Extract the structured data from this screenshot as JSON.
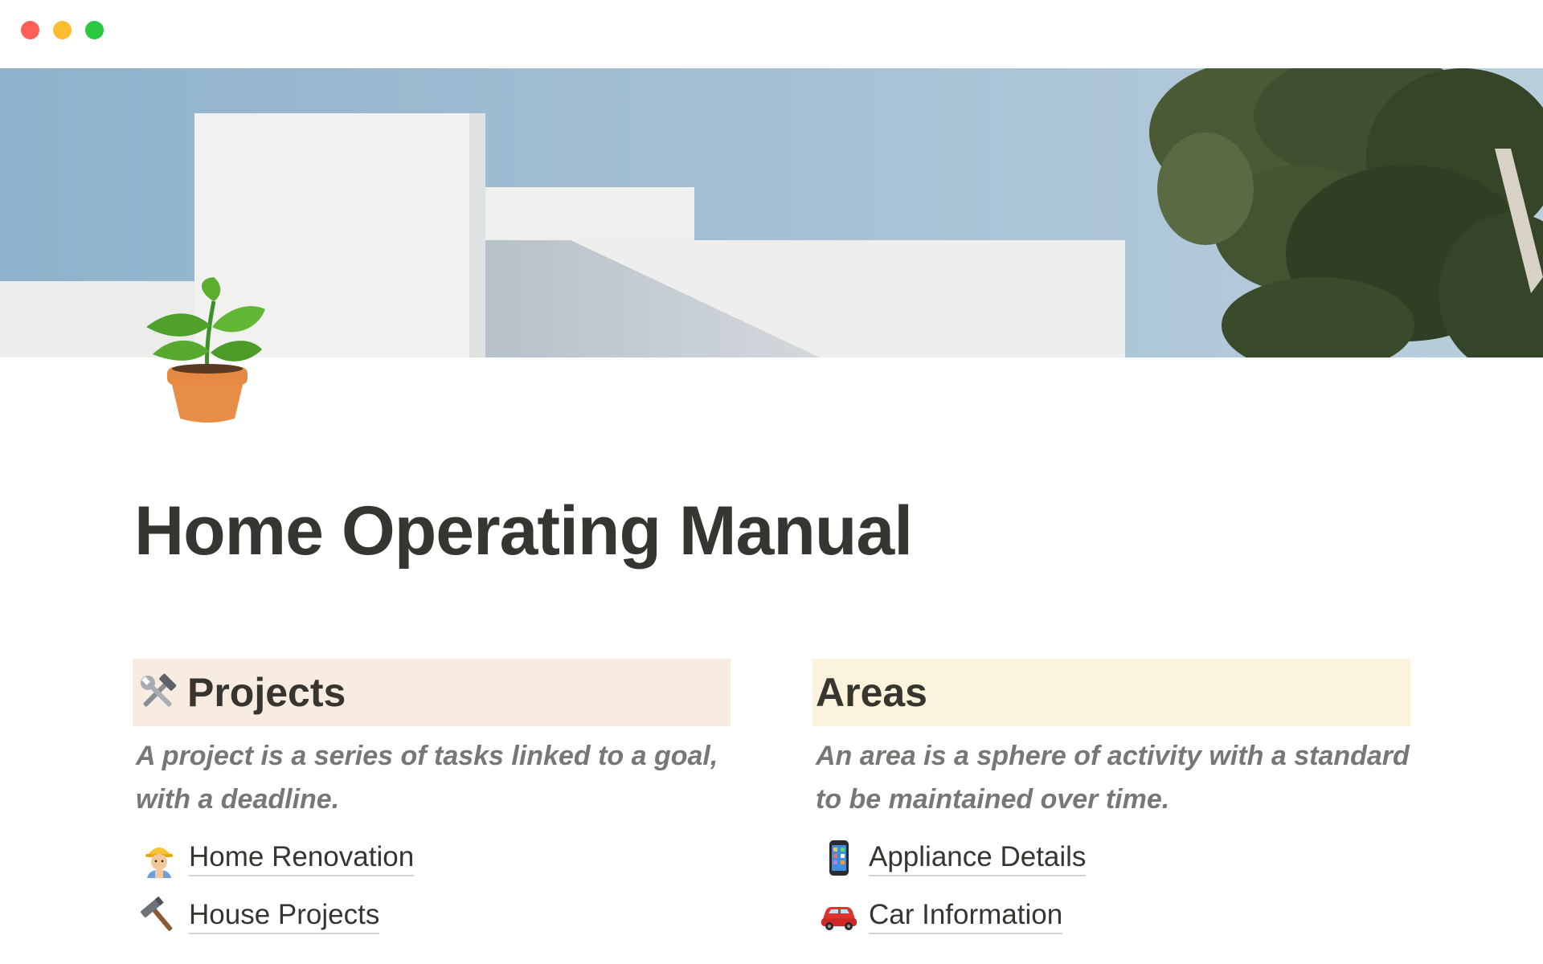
{
  "window": {
    "traffic_lights": {
      "close_color": "#ff5f57",
      "minimize_color": "#febc2e",
      "maximize_color": "#28c840"
    }
  },
  "cover": {
    "description_colors": {
      "sky": "#a9c3d6",
      "wall": "#eeeeec",
      "shadow": "#c4ccd3",
      "tree": "#3c4e2c"
    }
  },
  "page": {
    "icon": "potted-plant-icon",
    "title": "Home Operating Manual"
  },
  "sections": {
    "projects": {
      "icon": "hammer-and-wrench-icon",
      "heading": "Projects",
      "background": "#f8ebdf",
      "description": "A project is a series of tasks linked to a goal, with a deadline.",
      "links": [
        {
          "icon": "construction-worker-icon",
          "label": "Home Renovation"
        },
        {
          "icon": "hammer-icon",
          "label": "House Projects"
        }
      ]
    },
    "areas": {
      "heading": "Areas",
      "background": "#fbf3db",
      "description": "An area is a sphere of activity with a standard to be maintained over time.",
      "links": [
        {
          "icon": "mobile-phone-icon",
          "label": "Appliance Details"
        },
        {
          "icon": "car-icon",
          "label": "Car Information"
        }
      ]
    }
  }
}
